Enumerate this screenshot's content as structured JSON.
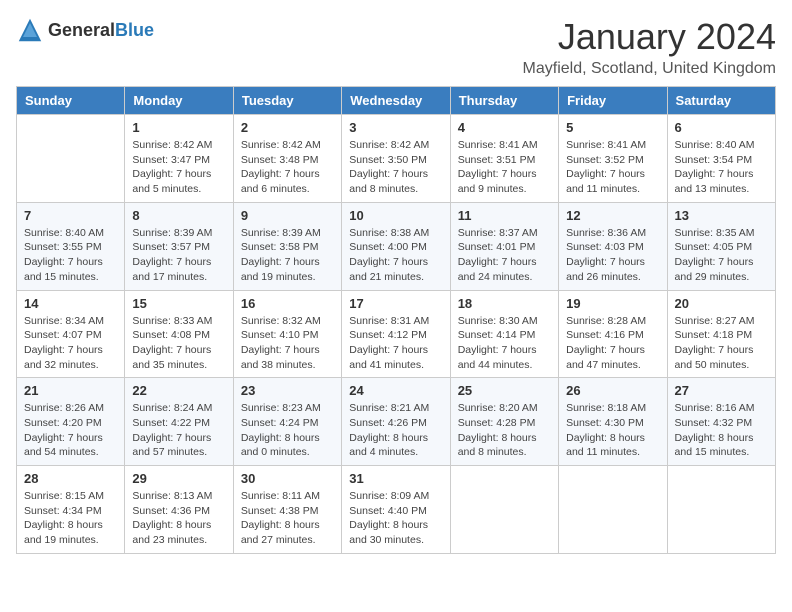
{
  "header": {
    "logo_general": "General",
    "logo_blue": "Blue",
    "month_title": "January 2024",
    "location": "Mayfield, Scotland, United Kingdom"
  },
  "days_of_week": [
    "Sunday",
    "Monday",
    "Tuesday",
    "Wednesday",
    "Thursday",
    "Friday",
    "Saturday"
  ],
  "weeks": [
    [
      {
        "day": "",
        "data": ""
      },
      {
        "day": "1",
        "data": "Sunrise: 8:42 AM\nSunset: 3:47 PM\nDaylight: 7 hours\nand 5 minutes."
      },
      {
        "day": "2",
        "data": "Sunrise: 8:42 AM\nSunset: 3:48 PM\nDaylight: 7 hours\nand 6 minutes."
      },
      {
        "day": "3",
        "data": "Sunrise: 8:42 AM\nSunset: 3:50 PM\nDaylight: 7 hours\nand 8 minutes."
      },
      {
        "day": "4",
        "data": "Sunrise: 8:41 AM\nSunset: 3:51 PM\nDaylight: 7 hours\nand 9 minutes."
      },
      {
        "day": "5",
        "data": "Sunrise: 8:41 AM\nSunset: 3:52 PM\nDaylight: 7 hours\nand 11 minutes."
      },
      {
        "day": "6",
        "data": "Sunrise: 8:40 AM\nSunset: 3:54 PM\nDaylight: 7 hours\nand 13 minutes."
      }
    ],
    [
      {
        "day": "7",
        "data": "Sunrise: 8:40 AM\nSunset: 3:55 PM\nDaylight: 7 hours\nand 15 minutes."
      },
      {
        "day": "8",
        "data": "Sunrise: 8:39 AM\nSunset: 3:57 PM\nDaylight: 7 hours\nand 17 minutes."
      },
      {
        "day": "9",
        "data": "Sunrise: 8:39 AM\nSunset: 3:58 PM\nDaylight: 7 hours\nand 19 minutes."
      },
      {
        "day": "10",
        "data": "Sunrise: 8:38 AM\nSunset: 4:00 PM\nDaylight: 7 hours\nand 21 minutes."
      },
      {
        "day": "11",
        "data": "Sunrise: 8:37 AM\nSunset: 4:01 PM\nDaylight: 7 hours\nand 24 minutes."
      },
      {
        "day": "12",
        "data": "Sunrise: 8:36 AM\nSunset: 4:03 PM\nDaylight: 7 hours\nand 26 minutes."
      },
      {
        "day": "13",
        "data": "Sunrise: 8:35 AM\nSunset: 4:05 PM\nDaylight: 7 hours\nand 29 minutes."
      }
    ],
    [
      {
        "day": "14",
        "data": "Sunrise: 8:34 AM\nSunset: 4:07 PM\nDaylight: 7 hours\nand 32 minutes."
      },
      {
        "day": "15",
        "data": "Sunrise: 8:33 AM\nSunset: 4:08 PM\nDaylight: 7 hours\nand 35 minutes."
      },
      {
        "day": "16",
        "data": "Sunrise: 8:32 AM\nSunset: 4:10 PM\nDaylight: 7 hours\nand 38 minutes."
      },
      {
        "day": "17",
        "data": "Sunrise: 8:31 AM\nSunset: 4:12 PM\nDaylight: 7 hours\nand 41 minutes."
      },
      {
        "day": "18",
        "data": "Sunrise: 8:30 AM\nSunset: 4:14 PM\nDaylight: 7 hours\nand 44 minutes."
      },
      {
        "day": "19",
        "data": "Sunrise: 8:28 AM\nSunset: 4:16 PM\nDaylight: 7 hours\nand 47 minutes."
      },
      {
        "day": "20",
        "data": "Sunrise: 8:27 AM\nSunset: 4:18 PM\nDaylight: 7 hours\nand 50 minutes."
      }
    ],
    [
      {
        "day": "21",
        "data": "Sunrise: 8:26 AM\nSunset: 4:20 PM\nDaylight: 7 hours\nand 54 minutes."
      },
      {
        "day": "22",
        "data": "Sunrise: 8:24 AM\nSunset: 4:22 PM\nDaylight: 7 hours\nand 57 minutes."
      },
      {
        "day": "23",
        "data": "Sunrise: 8:23 AM\nSunset: 4:24 PM\nDaylight: 8 hours\nand 0 minutes."
      },
      {
        "day": "24",
        "data": "Sunrise: 8:21 AM\nSunset: 4:26 PM\nDaylight: 8 hours\nand 4 minutes."
      },
      {
        "day": "25",
        "data": "Sunrise: 8:20 AM\nSunset: 4:28 PM\nDaylight: 8 hours\nand 8 minutes."
      },
      {
        "day": "26",
        "data": "Sunrise: 8:18 AM\nSunset: 4:30 PM\nDaylight: 8 hours\nand 11 minutes."
      },
      {
        "day": "27",
        "data": "Sunrise: 8:16 AM\nSunset: 4:32 PM\nDaylight: 8 hours\nand 15 minutes."
      }
    ],
    [
      {
        "day": "28",
        "data": "Sunrise: 8:15 AM\nSunset: 4:34 PM\nDaylight: 8 hours\nand 19 minutes."
      },
      {
        "day": "29",
        "data": "Sunrise: 8:13 AM\nSunset: 4:36 PM\nDaylight: 8 hours\nand 23 minutes."
      },
      {
        "day": "30",
        "data": "Sunrise: 8:11 AM\nSunset: 4:38 PM\nDaylight: 8 hours\nand 27 minutes."
      },
      {
        "day": "31",
        "data": "Sunrise: 8:09 AM\nSunset: 4:40 PM\nDaylight: 8 hours\nand 30 minutes."
      },
      {
        "day": "",
        "data": ""
      },
      {
        "day": "",
        "data": ""
      },
      {
        "day": "",
        "data": ""
      }
    ]
  ]
}
